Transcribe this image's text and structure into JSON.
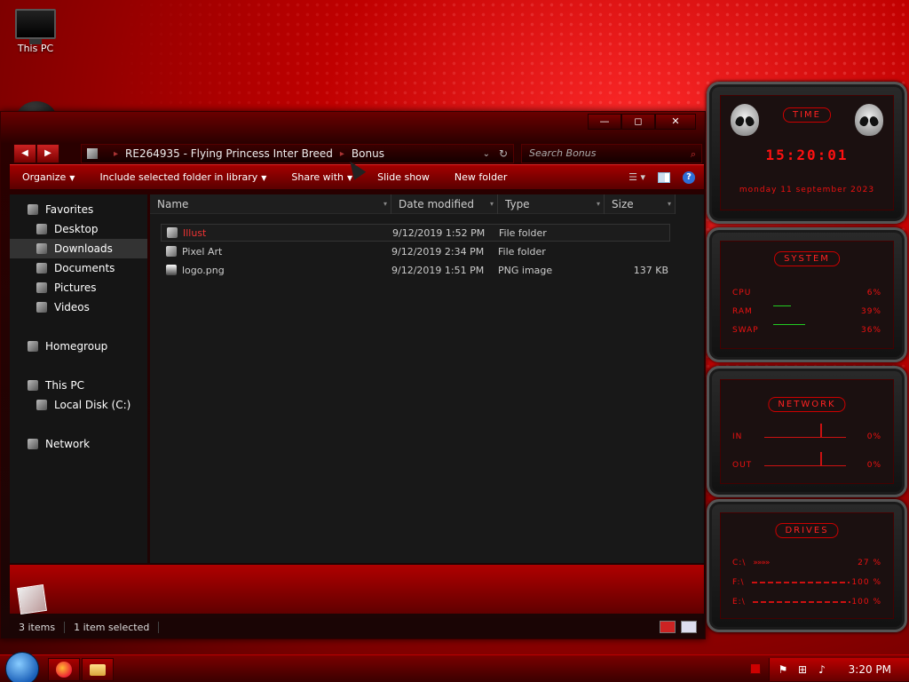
{
  "desktop": {
    "this_pc_label": "This PC"
  },
  "window": {
    "title_buttons": {
      "minimize": "—",
      "maximize": "◻",
      "close": "✕"
    },
    "nav": {
      "back": "◀",
      "forward": "▶"
    },
    "address": {
      "path_1": "RE264935 - Flying Princess Inter Breed",
      "path_2": "Bonus",
      "sep": "▸"
    },
    "search": {
      "placeholder": "Search Bonus"
    },
    "toolbar": {
      "organize": "Organize",
      "include_library": "Include selected folder in library",
      "share_with": "Share with",
      "slide_show": "Slide show",
      "new_folder": "New folder"
    },
    "navpane": {
      "favorites": "Favorites",
      "desktop": "Desktop",
      "downloads": "Downloads",
      "documents": "Documents",
      "pictures": "Pictures",
      "videos": "Videos",
      "homegroup": "Homegroup",
      "this_pc": "This PC",
      "local_disk": "Local Disk (C:)",
      "network": "Network"
    },
    "columns": {
      "name": "Name",
      "date_modified": "Date modified",
      "type": "Type",
      "size": "Size"
    },
    "files": [
      {
        "name": "Illust",
        "date": "9/12/2019 1:52 PM",
        "type": "File folder",
        "size": ""
      },
      {
        "name": "Pixel Art",
        "date": "9/12/2019 2:34 PM",
        "type": "File folder",
        "size": ""
      },
      {
        "name": "logo.png",
        "date": "9/12/2019 1:51 PM",
        "type": "PNG image",
        "size": "137 KB"
      }
    ],
    "status": {
      "items": "3 items",
      "selected": "1 item selected"
    }
  },
  "gadgets": {
    "time": {
      "title": "Time",
      "clock": "15:20:01",
      "date": "monday 11 september 2023"
    },
    "system": {
      "title": "System",
      "cpu_label": "CPU",
      "cpu_val": "6%",
      "ram_label": "RAM",
      "ram_val": "39%",
      "swap_label": "SWAP",
      "swap_val": "36%"
    },
    "network": {
      "title": "Network",
      "in_label": "IN",
      "in_val": "0%",
      "out_label": "OUT",
      "out_val": "0%"
    },
    "drives": {
      "title": "Drives",
      "c_label": "C:\\",
      "c_val": "27 %",
      "f_label": "F:\\",
      "f_val": "100 %",
      "e_label": "E:\\",
      "e_val": "100 %"
    }
  },
  "taskbar": {
    "time": "3:20 PM"
  },
  "colors": {
    "accent_red": "#cc0000",
    "text_red": "#e33333",
    "cpu_green": "#22cc22"
  }
}
